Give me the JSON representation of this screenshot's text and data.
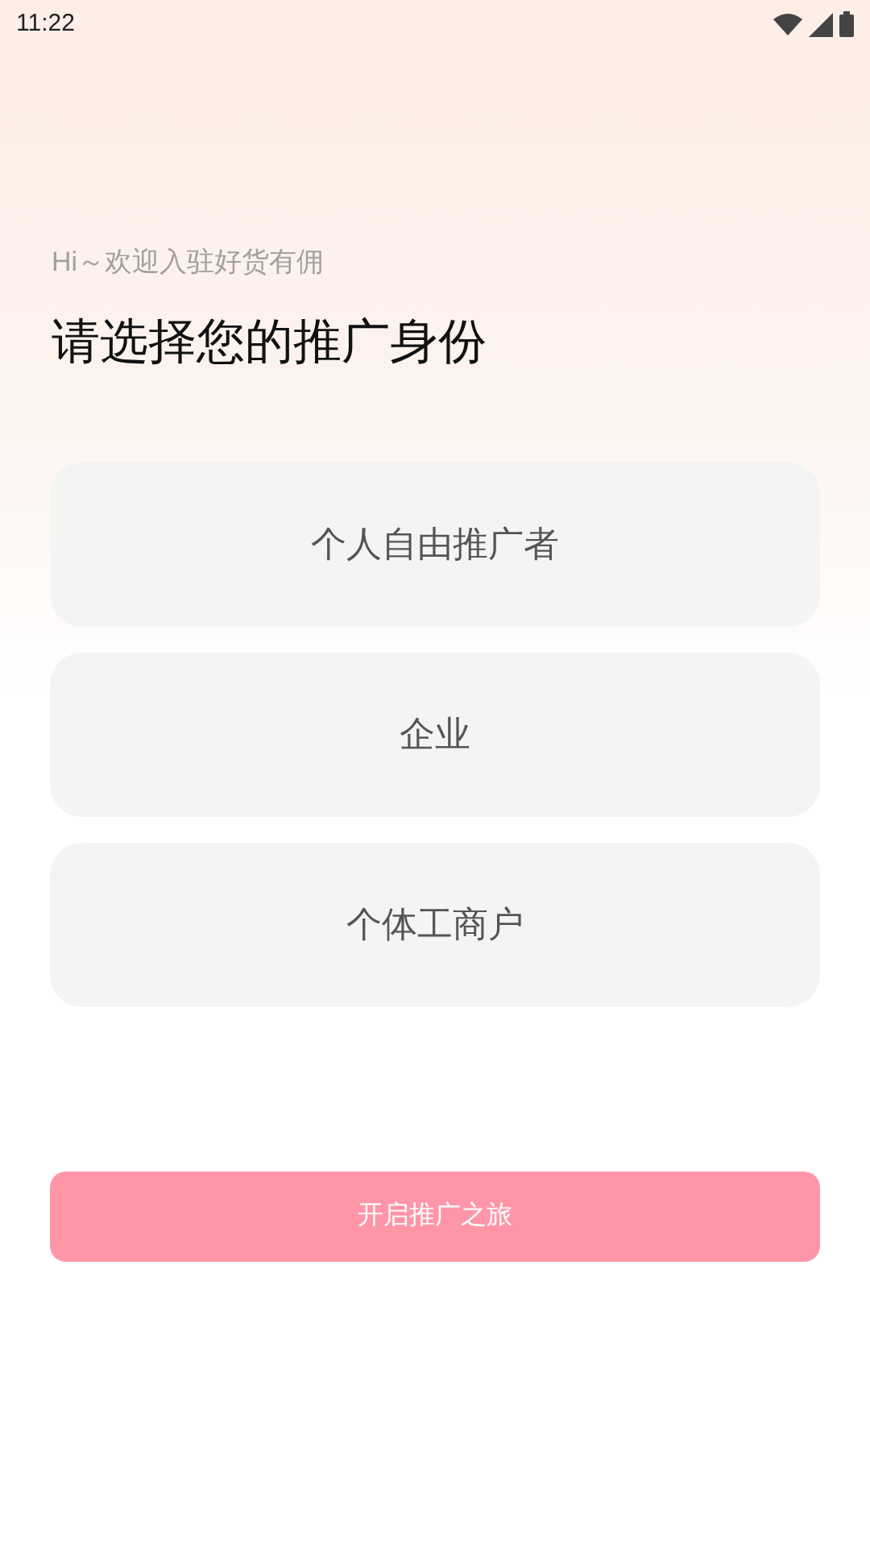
{
  "status_bar": {
    "time": "11:22"
  },
  "greeting": "Hi～欢迎入驻好货有佣",
  "title": "请选择您的推广身份",
  "options": [
    {
      "label": "个人自由推广者",
      "selected": false
    },
    {
      "label": "企业",
      "selected": false
    },
    {
      "label": "个体工商户",
      "selected": false
    }
  ],
  "start_button": {
    "label": "开启推广之旅",
    "disabled": true
  }
}
